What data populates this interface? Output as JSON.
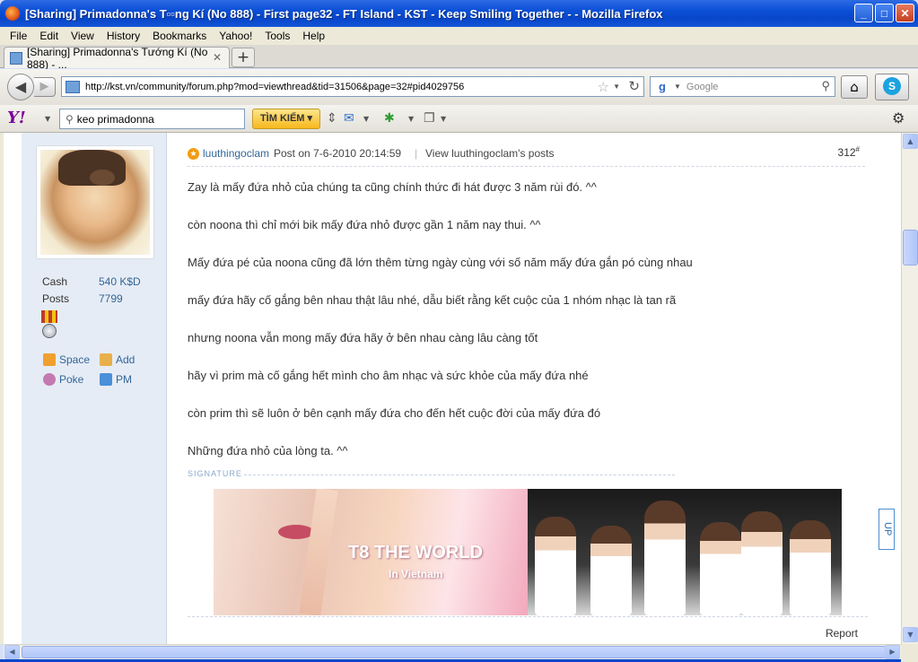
{
  "window": {
    "title": "[Sharing] Primadonna's T▫▫ng Kí (No 888) - First page32 - FT Island - KST - Keep Smiling Together - - Mozilla Firefox",
    "minimize": "_",
    "maximize": "□",
    "close": "✕"
  },
  "menu": [
    "File",
    "Edit",
    "View",
    "History",
    "Bookmarks",
    "Yahoo!",
    "Tools",
    "Help"
  ],
  "tab": {
    "label": "[Sharing] Primadonna's Tướng Kí (No 888) - ...",
    "close": "✕",
    "new_tab": "+"
  },
  "nav": {
    "url": "http://kst.vn/community/forum.php?mod=viewthread&tid=31506&page=32#pid4029756",
    "search_placeholder": "Google",
    "search_engine_icon": "google-icon"
  },
  "yahoo": {
    "logo": "Y!",
    "search_value": "keo primadonna",
    "search_button": "TÌM KIẾM ▾"
  },
  "author_panel": {
    "stats": [
      {
        "label": "Cash",
        "value": "540 K$D"
      },
      {
        "label": "Posts",
        "value": "7799"
      }
    ],
    "links": [
      {
        "label": "Space",
        "icon": "home-icon"
      },
      {
        "label": "Add",
        "icon": "handshake-icon"
      },
      {
        "label": "Poke",
        "icon": "poke-icon"
      },
      {
        "label": "PM",
        "icon": "envelope-icon"
      }
    ]
  },
  "post": {
    "author": "luuthingoclam",
    "posted_on": "Post on 7-6-2010 20:14:59",
    "separator": "|",
    "view_posts": "View luuthingoclam's posts",
    "floor": "312",
    "floor_mark": "#",
    "lines": [
      "Zay là mấy đứa nhỏ của chúng ta cũng chính thức đi hát được 3 năm rùi đó. ^^",
      "còn noona thì chỉ mới bik mấy đứa nhỏ được gần 1 năm nay thui. ^^",
      "Mấy đứa pé của noona cũng đã lớn thêm từng ngày cùng với số năm mấy đứa gắn pó cùng nhau",
      "mấy đứa hãy cố gắng bên nhau thật lâu nhé, dẫu biết rằng kết cuộc của 1 nhóm nhạc là tan rã",
      "nhưng noona vẫn mong mấy đứa hãy ở bên nhau càng lâu càng tốt",
      "hãy vì prim mà cố gắng hết mình cho âm nhạc và sức khỏe của mấy đứa nhé",
      "còn prim thì sẽ luôn ở bên cạnh mấy đứa cho đến hết cuộc đời của mấy đứa đó",
      "Những đứa nhỏ của lòng ta. ^^"
    ],
    "signature_label": "SIGNATURE",
    "banner_title": "T8 THE WORLD",
    "banner_subtitle": "In Vietnam",
    "report": "Report"
  },
  "up_button": "UP"
}
